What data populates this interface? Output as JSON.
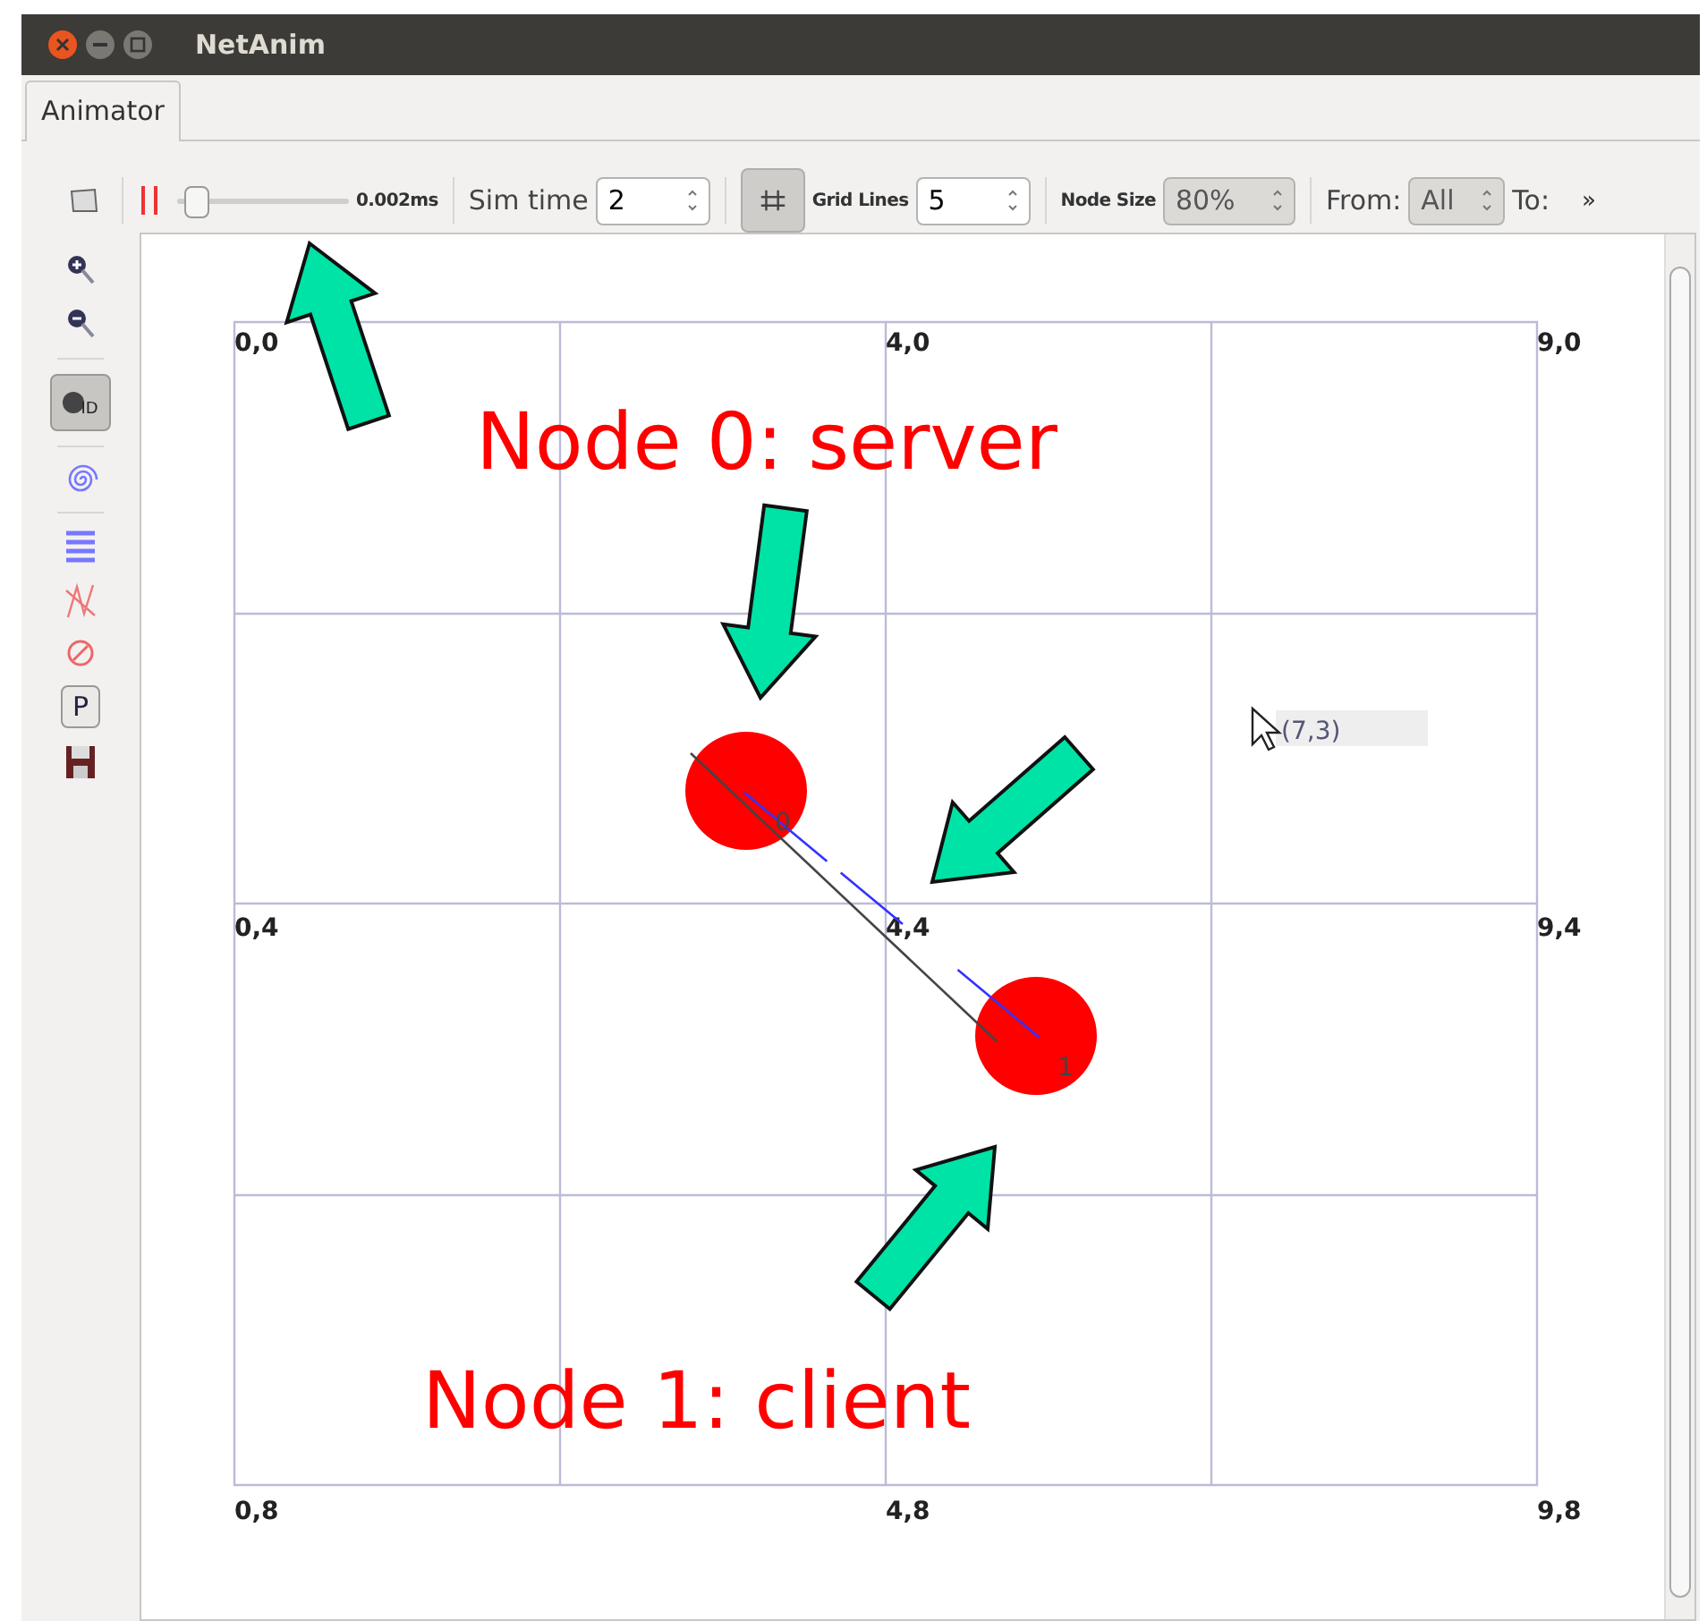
{
  "window": {
    "title": "NetAnim"
  },
  "tabs": [
    {
      "label": "Animator",
      "selected": true
    }
  ],
  "toolbar": {
    "slider": {
      "level": 0.08,
      "reading": "0.002ms"
    },
    "sim_time": {
      "label": "Sim time",
      "value": "2"
    },
    "grid_toggle": {
      "pressed": true
    },
    "grid_lines": {
      "label": "Grid Lines",
      "value": "5"
    },
    "node_size": {
      "label": "Node Size",
      "value": "80%"
    },
    "from": {
      "label": "From:",
      "value": "All"
    },
    "to": {
      "label": "To:"
    },
    "more": "»"
  },
  "sidebar": [
    {
      "kind": "zoom_in"
    },
    {
      "kind": "zoom_out"
    },
    {
      "kind": "separator"
    },
    {
      "kind": "node_id",
      "label": "ID",
      "pressed": true
    },
    {
      "kind": "separator"
    },
    {
      "kind": "spiral"
    },
    {
      "kind": "separator"
    },
    {
      "kind": "list"
    },
    {
      "kind": "no_links"
    },
    {
      "kind": "forbid"
    },
    {
      "kind": "packet",
      "label": "P",
      "pressed": false
    },
    {
      "kind": "save"
    }
  ],
  "canvas": {
    "grid_labels": [
      "0,0",
      "4,0",
      "9,0",
      "0,4",
      "4,4",
      "9,4",
      "0,8",
      "4,8",
      "9,8"
    ],
    "nodes": [
      {
        "id": "0"
      },
      {
        "id": "1"
      }
    ],
    "pointer": {
      "coords": "(7,3)"
    },
    "annotations": [
      "Node 0: server",
      "Node 1: client"
    ]
  }
}
